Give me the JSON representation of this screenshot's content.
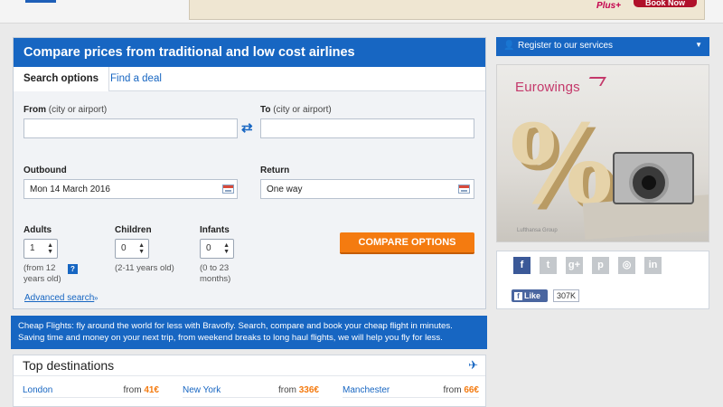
{
  "top_ad": {
    "brand": "Plus+",
    "button_label": "Book Now"
  },
  "search": {
    "title": "Compare prices from traditional and low cost airlines",
    "tabs": [
      {
        "label": "Search options",
        "active": true
      },
      {
        "label": "Find a deal",
        "active": false
      }
    ],
    "from": {
      "label": "From",
      "hint": "(city or airport)",
      "value": "",
      "placeholder": ""
    },
    "to": {
      "label": "To",
      "hint": "(city or airport)",
      "value": "",
      "placeholder": ""
    },
    "outbound": {
      "label": "Outbound",
      "value": "Mon 14 March 2016"
    },
    "return": {
      "label": "Return",
      "value": "One way"
    },
    "passengers": {
      "adults": {
        "label": "Adults",
        "value": "1",
        "hint": "(from 12 years old)"
      },
      "children": {
        "label": "Children",
        "value": "0",
        "hint": "(2-11 years old)"
      },
      "infants": {
        "label": "Infants",
        "value": "0",
        "hint": "(0 to 23 months)"
      }
    },
    "advanced_link": "Advanced search",
    "compare_button": "COMPARE OPTIONS",
    "help_glyph": "?"
  },
  "info_banner": "Cheap Flights: fly around the world for less with Bravofly. Search, compare and book your cheap flight in minutes. Saving time and money on your next trip, from weekend breaks to long haul flights, we will help you fly for less.",
  "destinations": {
    "title": "Top destinations",
    "items": [
      {
        "city": "London",
        "from_label": "from",
        "price": "41€"
      },
      {
        "city": "New York",
        "from_label": "from",
        "price": "336€"
      },
      {
        "city": "Manchester",
        "from_label": "from",
        "price": "66€"
      }
    ]
  },
  "sidebar": {
    "register_label": "Register to our services",
    "ad": {
      "brand": "Eurowings",
      "sponsor": "Lufthansa Group"
    },
    "social": {
      "networks": [
        {
          "name": "facebook",
          "glyph": "f"
        },
        {
          "name": "twitter",
          "glyph": "t"
        },
        {
          "name": "google-plus",
          "glyph": "g+"
        },
        {
          "name": "pinterest",
          "glyph": "p"
        },
        {
          "name": "instagram",
          "glyph": "◎"
        },
        {
          "name": "linkedin",
          "glyph": "in"
        }
      ],
      "like_label": "Like",
      "like_count": "307K"
    }
  },
  "colors": {
    "brand_blue": "#1766c2",
    "accent_orange": "#f47b10",
    "facebook_blue": "#3b5998"
  }
}
